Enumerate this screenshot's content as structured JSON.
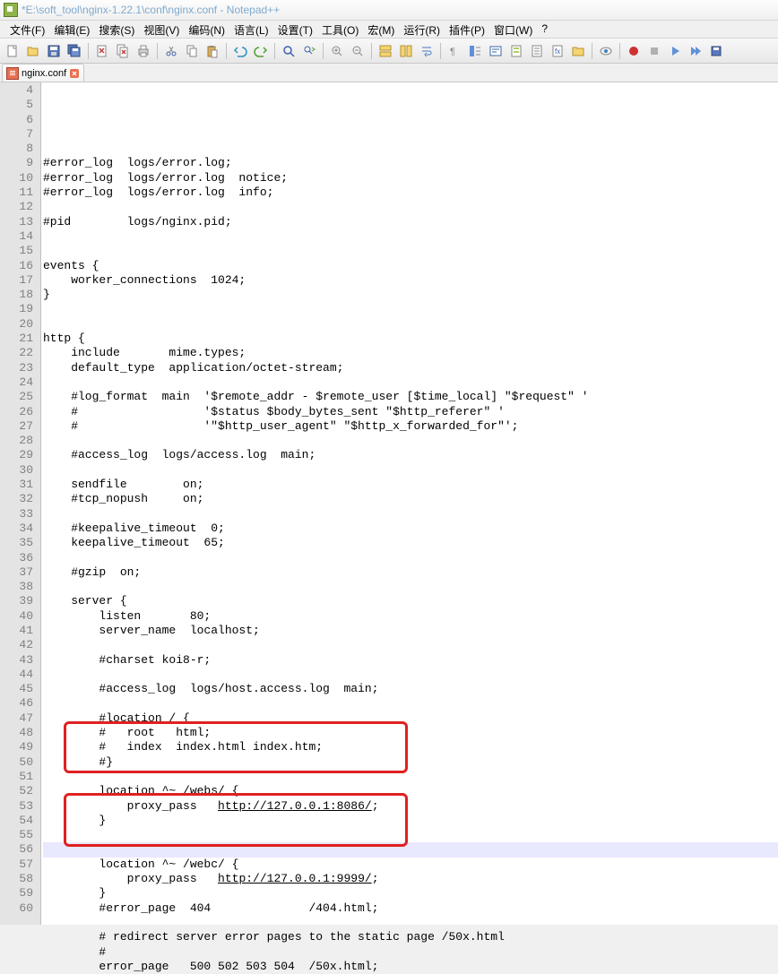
{
  "title": "*E:\\soft_tool\\nginx-1.22.1\\conf\\nginx.conf - Notepad++",
  "menu": [
    "文件(F)",
    "编辑(E)",
    "搜索(S)",
    "视图(V)",
    "编码(N)",
    "语言(L)",
    "设置(T)",
    "工具(O)",
    "宏(M)",
    "运行(R)",
    "插件(P)",
    "窗口(W)",
    "?"
  ],
  "tab": {
    "name": "nginx.conf",
    "close": "×"
  },
  "lines": [
    {
      "n": 4,
      "t": ""
    },
    {
      "n": 5,
      "t": "#error_log  logs/error.log;"
    },
    {
      "n": 6,
      "t": "#error_log  logs/error.log  notice;"
    },
    {
      "n": 7,
      "t": "#error_log  logs/error.log  info;"
    },
    {
      "n": 8,
      "t": ""
    },
    {
      "n": 9,
      "t": "#pid        logs/nginx.pid;"
    },
    {
      "n": 10,
      "t": ""
    },
    {
      "n": 11,
      "t": ""
    },
    {
      "n": 12,
      "t": "events {"
    },
    {
      "n": 13,
      "t": "    worker_connections  1024;"
    },
    {
      "n": 14,
      "t": "}"
    },
    {
      "n": 15,
      "t": ""
    },
    {
      "n": 16,
      "t": ""
    },
    {
      "n": 17,
      "t": "http {"
    },
    {
      "n": 18,
      "t": "    include       mime.types;"
    },
    {
      "n": 19,
      "t": "    default_type  application/octet-stream;"
    },
    {
      "n": 20,
      "t": ""
    },
    {
      "n": 21,
      "t": "    #log_format  main  '$remote_addr - $remote_user [$time_local] \"$request\" '"
    },
    {
      "n": 22,
      "t": "    #                  '$status $body_bytes_sent \"$http_referer\" '"
    },
    {
      "n": 23,
      "t": "    #                  '\"$http_user_agent\" \"$http_x_forwarded_for\"';"
    },
    {
      "n": 24,
      "t": ""
    },
    {
      "n": 25,
      "t": "    #access_log  logs/access.log  main;"
    },
    {
      "n": 26,
      "t": ""
    },
    {
      "n": 27,
      "t": "    sendfile        on;"
    },
    {
      "n": 28,
      "t": "    #tcp_nopush     on;"
    },
    {
      "n": 29,
      "t": ""
    },
    {
      "n": 30,
      "t": "    #keepalive_timeout  0;"
    },
    {
      "n": 31,
      "t": "    keepalive_timeout  65;"
    },
    {
      "n": 32,
      "t": ""
    },
    {
      "n": 33,
      "t": "    #gzip  on;"
    },
    {
      "n": 34,
      "t": ""
    },
    {
      "n": 35,
      "t": "    server {"
    },
    {
      "n": 36,
      "t": "        listen       80;"
    },
    {
      "n": 37,
      "t": "        server_name  localhost;"
    },
    {
      "n": 38,
      "t": ""
    },
    {
      "n": 39,
      "t": "        #charset koi8-r;"
    },
    {
      "n": 40,
      "t": ""
    },
    {
      "n": 41,
      "t": "        #access_log  logs/host.access.log  main;"
    },
    {
      "n": 42,
      "t": ""
    },
    {
      "n": 43,
      "t": "        #location / {"
    },
    {
      "n": 44,
      "t": "        #   root   html;"
    },
    {
      "n": 45,
      "t": "        #   index  index.html index.htm;"
    },
    {
      "n": 46,
      "t": "        #}"
    },
    {
      "n": 47,
      "t": ""
    },
    {
      "n": 48,
      "t": "        location ^~ /webs/ {"
    },
    {
      "n": 49,
      "t": "            proxy_pass   ",
      "u": "http://127.0.0.1:8086/",
      "a": ";"
    },
    {
      "n": 50,
      "t": "        }"
    },
    {
      "n": 51,
      "t": ""
    },
    {
      "n": 52,
      "t": "",
      "hl": true
    },
    {
      "n": 53,
      "t": "        location ^~ /webc/ {"
    },
    {
      "n": 54,
      "t": "            proxy_pass   ",
      "u": "http://127.0.0.1:9999/",
      "a": ";"
    },
    {
      "n": 55,
      "t": "        }"
    },
    {
      "n": 56,
      "t": "        #error_page  404              /404.html;"
    },
    {
      "n": 57,
      "t": ""
    },
    {
      "n": 58,
      "t": "        # redirect server error pages to the static page /50x.html"
    },
    {
      "n": 59,
      "t": "        #"
    },
    {
      "n": 60,
      "t": "        error_page   500 502 503 504  /50x.html;"
    }
  ]
}
